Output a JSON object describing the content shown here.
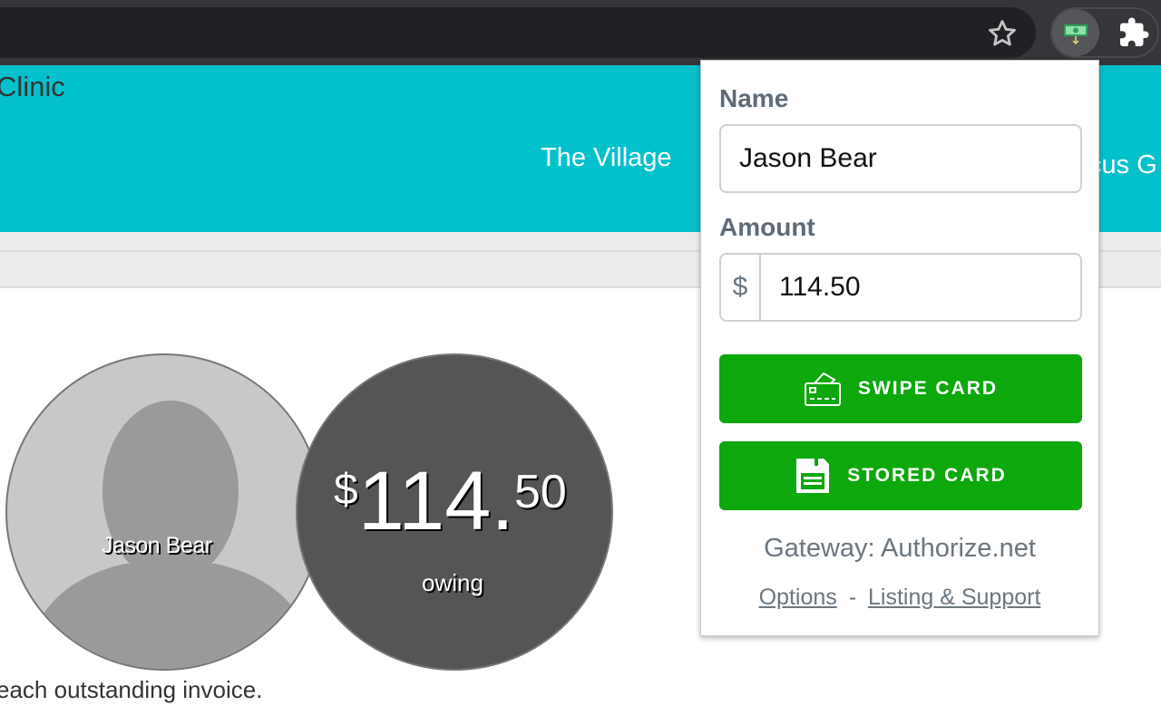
{
  "browser": {
    "bookmark_icon": "star-icon",
    "extension_icon": "money-icon",
    "extensions_icon": "puzzle-icon"
  },
  "page": {
    "clinic_title": "Clinic",
    "location": "The Village",
    "location_partial": "cus G",
    "patient_name": "Jason Bear",
    "amount": {
      "currency": "$",
      "whole": "114.",
      "cents": "50"
    },
    "owing_label": "owing",
    "footer_text": "each outstanding invoice."
  },
  "popup": {
    "name_label": "Name",
    "name_value": "Jason Bear",
    "amount_label": "Amount",
    "amount_prefix": "$",
    "amount_value": "114.50",
    "swipe_label": "SWIPE CARD",
    "stored_label": "STORED CARD",
    "gateway": "Gateway: Authorize.net",
    "options_link": "Options",
    "separator": "-",
    "support_link": "Listing & Support"
  },
  "colors": {
    "header": "#02c1cc",
    "button": "#0ca80c",
    "label": "#5f6b75"
  }
}
